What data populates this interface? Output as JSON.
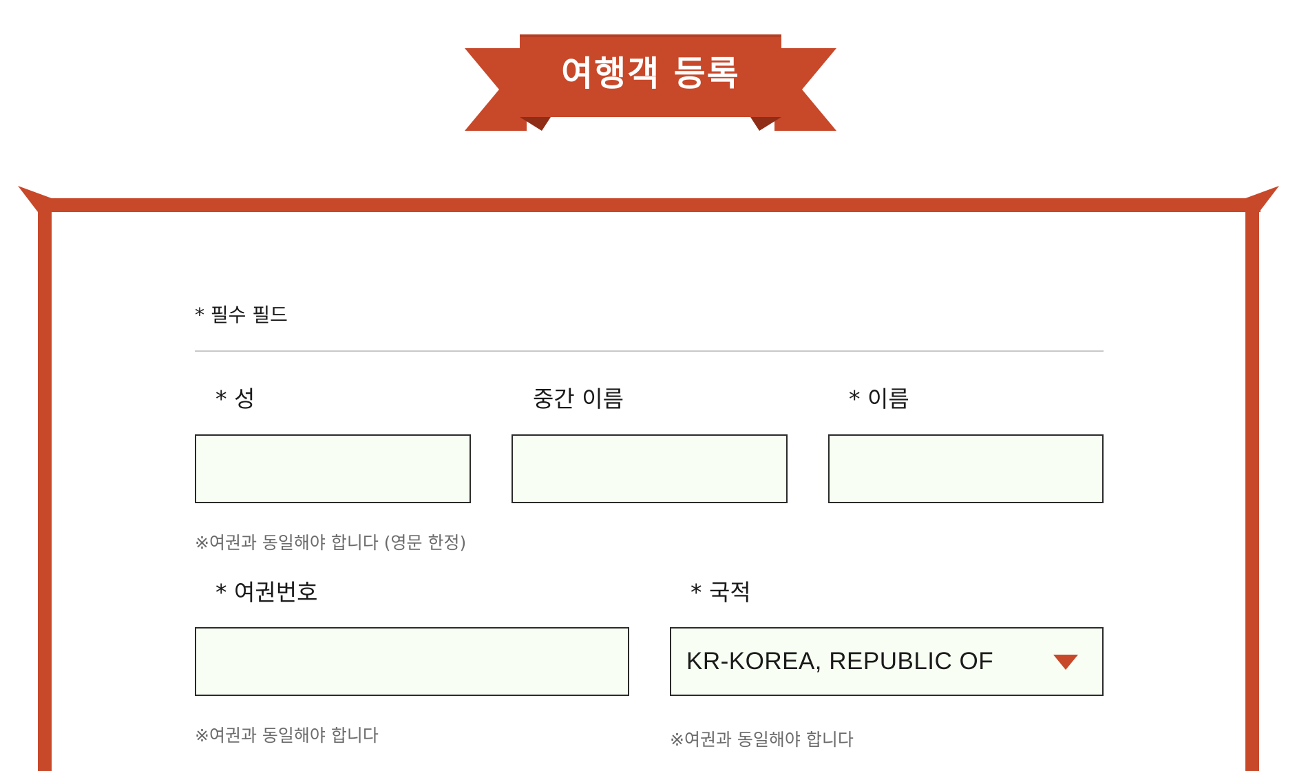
{
  "banner": {
    "title": "여행객 등록"
  },
  "form": {
    "required_note": "* 필수 필드",
    "last_name": {
      "label": "* 성",
      "value": ""
    },
    "middle_name": {
      "label": "중간 이름",
      "value": ""
    },
    "first_name": {
      "label": "* 이름",
      "value": ""
    },
    "name_hint": "※여권과 동일해야 합니다 (영문 한정)",
    "passport_number": {
      "label": "* 여권번호",
      "value": "",
      "hint": "※여권과 동일해야 합니다"
    },
    "nationality": {
      "label": "* 국적",
      "selected": "KR-KOREA, REPUBLIC OF",
      "hint": "※여권과 동일해야 합니다"
    }
  },
  "colors": {
    "accent": "#c8482a",
    "accent_dark": "#9c3219",
    "input_background": "#f8fef3",
    "input_border": "#2a2a2a",
    "hint_text": "#6b6b6b",
    "divider": "#c8c8c8"
  }
}
